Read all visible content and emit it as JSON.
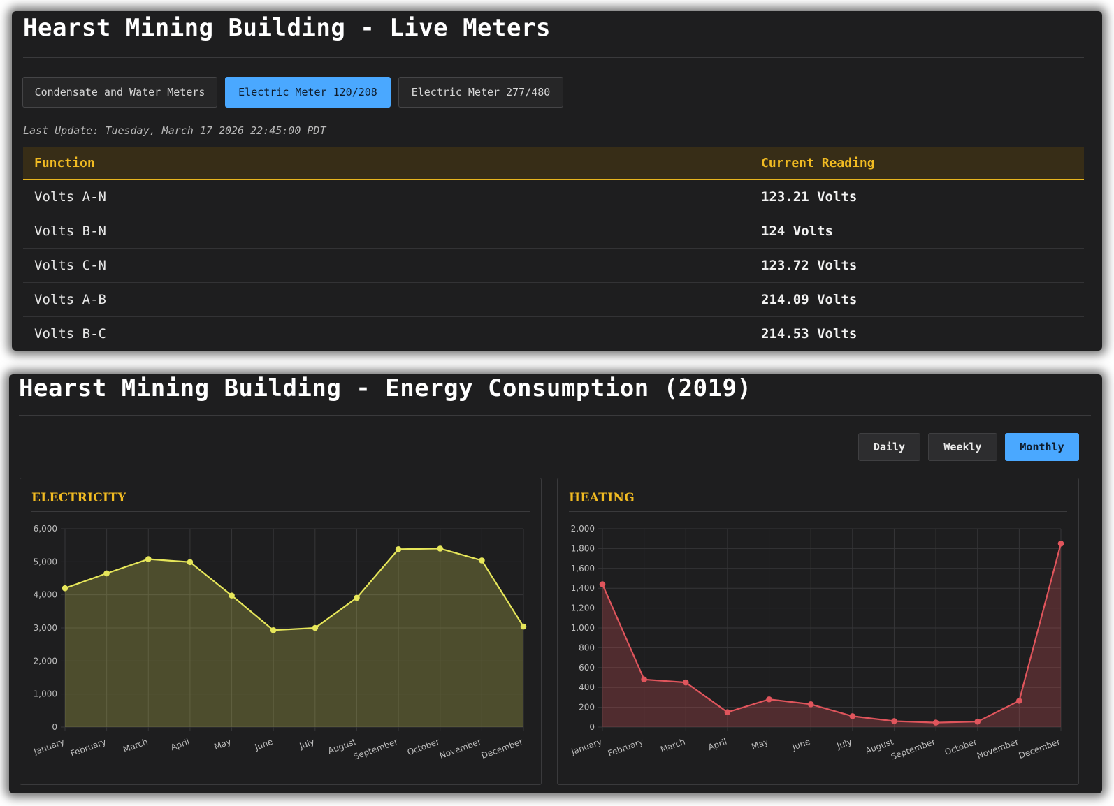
{
  "meters": {
    "title": "Hearst Mining Building - Live Meters",
    "tabs": [
      {
        "label": "Condensate and Water Meters",
        "active": false
      },
      {
        "label": "Electric Meter 120/208",
        "active": true
      },
      {
        "label": "Electric Meter 277/480",
        "active": false
      }
    ],
    "last_update": "Last Update: Tuesday, March 17 2026 22:45:00 PDT",
    "table": {
      "headers": [
        "Function",
        "Current Reading"
      ],
      "rows": [
        {
          "function": "Volts A-N",
          "reading": "123.21 Volts"
        },
        {
          "function": "Volts B-N",
          "reading": "124 Volts"
        },
        {
          "function": "Volts C-N",
          "reading": "123.72 Volts"
        },
        {
          "function": "Volts A-B",
          "reading": "214.09 Volts"
        },
        {
          "function": "Volts B-C",
          "reading": "214.53 Volts"
        }
      ]
    }
  },
  "energy": {
    "title": "Hearst Mining Building - Energy Consumption (2019)",
    "periods": [
      {
        "label": "Daily",
        "active": false
      },
      {
        "label": "Weekly",
        "active": false
      },
      {
        "label": "Monthly",
        "active": true
      }
    ]
  },
  "colors": {
    "accent": "#4aa8ff",
    "header_gold": "#f1bb22",
    "electricity_line": "#e6e65a",
    "heating_line": "#e0555c"
  },
  "chart_data": [
    {
      "type": "area",
      "title": "ELECTRICITY",
      "categories": [
        "January",
        "February",
        "March",
        "April",
        "May",
        "June",
        "July",
        "August",
        "September",
        "October",
        "November",
        "December"
      ],
      "values": [
        4200,
        4650,
        5080,
        4990,
        3980,
        2930,
        3000,
        3910,
        5380,
        5400,
        5040,
        3040
      ],
      "ylim": [
        0,
        6000
      ],
      "yticks": [
        "0",
        "1,000",
        "2,000",
        "3,000",
        "4,000",
        "5,000",
        "6,000"
      ],
      "grid": true,
      "line_color": "#e6e65a",
      "fill_color": "rgba(230,230,90,0.24)"
    },
    {
      "type": "area",
      "title": "HEATING",
      "categories": [
        "January",
        "February",
        "March",
        "April",
        "May",
        "June",
        "July",
        "August",
        "September",
        "October",
        "November",
        "December"
      ],
      "values": [
        1440,
        480,
        450,
        150,
        280,
        230,
        110,
        60,
        45,
        55,
        265,
        1850
      ],
      "ylim": [
        0,
        2000
      ],
      "yticks": [
        "0",
        "200",
        "400",
        "600",
        "800",
        "1,000",
        "1,200",
        "1,400",
        "1,600",
        "1,800",
        "2,000"
      ],
      "grid": true,
      "line_color": "#e0555c",
      "fill_color": "rgba(224,85,92,0.26)"
    }
  ]
}
